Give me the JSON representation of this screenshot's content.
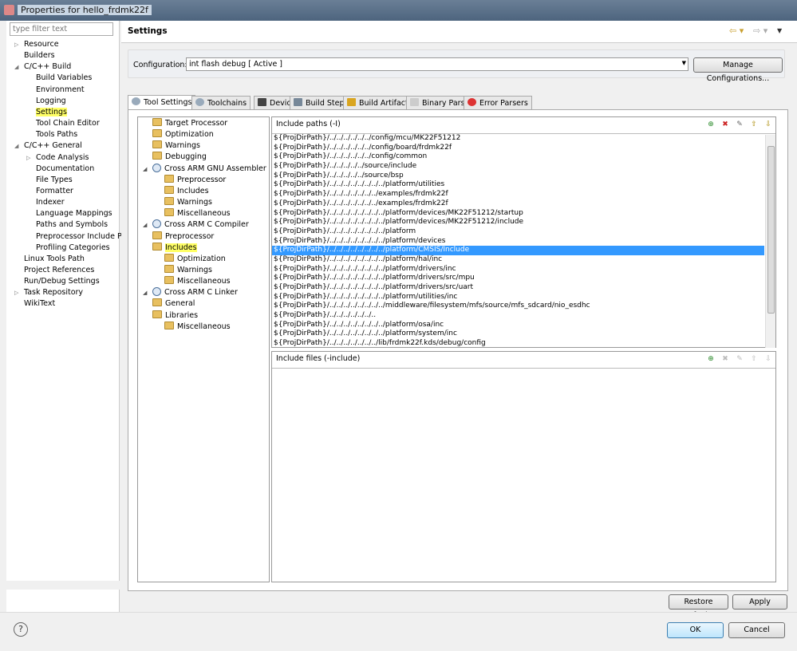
{
  "window": {
    "title": "Properties for hello_frdmk22f"
  },
  "left": {
    "filter_placeholder": "type filter text",
    "items": [
      {
        "label": "Resource",
        "level": 0,
        "tw": "▷"
      },
      {
        "label": "Builders",
        "level": 0,
        "tw": ""
      },
      {
        "label": "C/C++ Build",
        "level": 0,
        "tw": "◢"
      },
      {
        "label": "Build Variables",
        "level": 1,
        "tw": ""
      },
      {
        "label": "Environment",
        "level": 1,
        "tw": ""
      },
      {
        "label": "Logging",
        "level": 1,
        "tw": ""
      },
      {
        "label": "Settings",
        "level": 1,
        "tw": "",
        "selected": true
      },
      {
        "label": "Tool Chain Editor",
        "level": 1,
        "tw": ""
      },
      {
        "label": "Tools Paths",
        "level": 1,
        "tw": ""
      },
      {
        "label": "C/C++ General",
        "level": 0,
        "tw": "◢"
      },
      {
        "label": "Code Analysis",
        "level": 1,
        "tw": "▷"
      },
      {
        "label": "Documentation",
        "level": 1,
        "tw": ""
      },
      {
        "label": "File Types",
        "level": 1,
        "tw": ""
      },
      {
        "label": "Formatter",
        "level": 1,
        "tw": ""
      },
      {
        "label": "Indexer",
        "level": 1,
        "tw": ""
      },
      {
        "label": "Language Mappings",
        "level": 1,
        "tw": ""
      },
      {
        "label": "Paths and Symbols",
        "level": 1,
        "tw": ""
      },
      {
        "label": "Preprocessor Include Pa",
        "level": 1,
        "tw": ""
      },
      {
        "label": "Profiling Categories",
        "level": 1,
        "tw": ""
      },
      {
        "label": "Linux Tools Path",
        "level": 0,
        "tw": ""
      },
      {
        "label": "Project References",
        "level": 0,
        "tw": ""
      },
      {
        "label": "Run/Debug Settings",
        "level": 0,
        "tw": ""
      },
      {
        "label": "Task Repository",
        "level": 0,
        "tw": "▷"
      },
      {
        "label": "WikiText",
        "level": 0,
        "tw": ""
      }
    ]
  },
  "header": {
    "title": "Settings"
  },
  "config": {
    "label": "Configuration:",
    "value": "int flash debug  [ Active ]",
    "manage_label": "Manage Configurations..."
  },
  "tabs": [
    {
      "label": "Tool Settings",
      "active": true,
      "icon": "gear-icon"
    },
    {
      "label": "Toolchains",
      "icon": "gear-icon"
    },
    {
      "label": "Devices",
      "icon": "chip-icon"
    },
    {
      "label": "Build Steps",
      "icon": "hammer-icon"
    },
    {
      "label": "Build Artifact",
      "icon": "artifact-icon"
    },
    {
      "label": "Binary Parsers",
      "icon": "binary-icon"
    },
    {
      "label": "Error Parsers",
      "icon": "error-icon"
    }
  ],
  "tree": [
    {
      "label": "Target Processor",
      "level": 1,
      "type": "folder"
    },
    {
      "label": "Optimization",
      "level": 1,
      "type": "folder"
    },
    {
      "label": "Warnings",
      "level": 1,
      "type": "folder"
    },
    {
      "label": "Debugging",
      "level": 1,
      "type": "folder"
    },
    {
      "label": "Cross ARM GNU Assembler",
      "level": 0,
      "type": "tool"
    },
    {
      "label": "Preprocessor",
      "level": 2,
      "type": "folder"
    },
    {
      "label": "Includes",
      "level": 2,
      "type": "folder"
    },
    {
      "label": "Warnings",
      "level": 2,
      "type": "folder"
    },
    {
      "label": "Miscellaneous",
      "level": 2,
      "type": "folder"
    },
    {
      "label": "Cross ARM C Compiler",
      "level": 0,
      "type": "tool"
    },
    {
      "label": "Preprocessor",
      "level": 1,
      "type": "folder"
    },
    {
      "label": "Includes",
      "level": 1,
      "type": "folder",
      "selected": true
    },
    {
      "label": "Optimization",
      "level": 2,
      "type": "folder"
    },
    {
      "label": "Warnings",
      "level": 2,
      "type": "folder"
    },
    {
      "label": "Miscellaneous",
      "level": 2,
      "type": "folder"
    },
    {
      "label": "Cross ARM C Linker",
      "level": 0,
      "type": "tool"
    },
    {
      "label": "General",
      "level": 1,
      "type": "folder"
    },
    {
      "label": "Libraries",
      "level": 1,
      "type": "folder"
    },
    {
      "label": "Miscellaneous",
      "level": 2,
      "type": "folder"
    }
  ],
  "include_paths": {
    "title": "Include paths (-I)",
    "selected_index": 12,
    "items": [
      "${ProjDirPath}/../../../../../../config/mcu/MK22F51212",
      "${ProjDirPath}/../../../../../../config/board/frdmk22f",
      "${ProjDirPath}/../../../../../../config/common",
      "${ProjDirPath}/../../../../../source/include",
      "${ProjDirPath}/../../../../../source/bsp",
      "${ProjDirPath}/../../../../../../../../platform/utilities",
      "${ProjDirPath}/../../../../../../../examples/frdmk22f",
      "${ProjDirPath}/../../../../../../../examples/frdmk22f",
      "${ProjDirPath}/../../../../../../../../platform/devices/MK22F51212/startup",
      "${ProjDirPath}/../../../../../../../../platform/devices/MK22F51212/include",
      "${ProjDirPath}/../../../../../../../../platform",
      "${ProjDirPath}/../../../../../../../../platform/devices",
      "${ProjDirPath}/../../../../../../../../platform/CMSIS/Include",
      "${ProjDirPath}/../../../../../../../../platform/hal/inc",
      "${ProjDirPath}/../../../../../../../../platform/drivers/inc",
      "${ProjDirPath}/../../../../../../../../platform/drivers/src/mpu",
      "${ProjDirPath}/../../../../../../../../platform/drivers/src/uart",
      "${ProjDirPath}/../../../../../../../../platform/utilities/inc",
      "${ProjDirPath}/../../../../../../../../middleware/filesystem/mfs/source/mfs_sdcard/nio_esdhc",
      "${ProjDirPath}/../../../../../../..",
      "${ProjDirPath}/../../../../../../../../platform/osa/inc",
      "${ProjDirPath}/../../../../../../../../platform/system/inc",
      "${ProjDirPath}/../../../../../../../lib/frdmk22f.kds/debug/config"
    ]
  },
  "include_files": {
    "title": "Include files (-include)",
    "items": []
  },
  "toolbar_icons": [
    "add-icon",
    "delete-icon",
    "edit-icon",
    "move-up-icon",
    "move-down-icon"
  ],
  "buttons": {
    "restore": "Restore Defaults",
    "apply": "Apply",
    "ok": "OK",
    "cancel": "Cancel",
    "help": "?"
  },
  "colors": {
    "selection": "#3399ff",
    "highlight": "#ffff66"
  }
}
